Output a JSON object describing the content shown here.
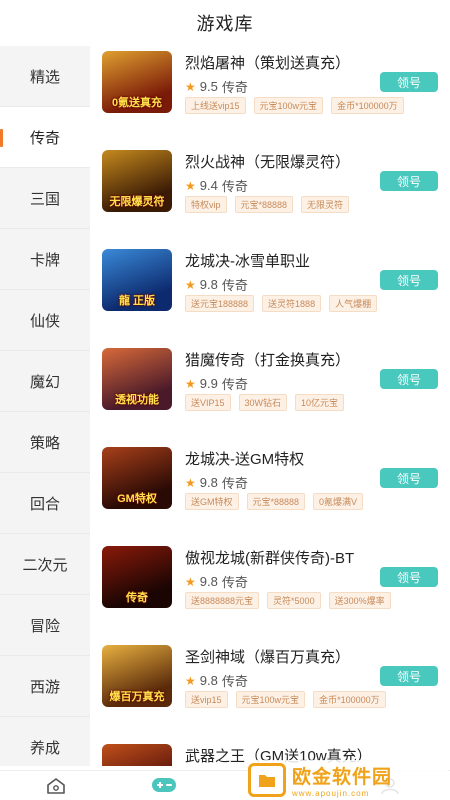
{
  "header": {
    "title": "游戏库"
  },
  "sidebar": {
    "items": [
      {
        "label": "精选",
        "active": false
      },
      {
        "label": "传奇",
        "active": true
      },
      {
        "label": "三国",
        "active": false
      },
      {
        "label": "卡牌",
        "active": false
      },
      {
        "label": "仙侠",
        "active": false
      },
      {
        "label": "魔幻",
        "active": false
      },
      {
        "label": "策略",
        "active": false
      },
      {
        "label": "回合",
        "active": false
      },
      {
        "label": "二次元",
        "active": false
      },
      {
        "label": "冒险",
        "active": false
      },
      {
        "label": "西游",
        "active": false
      },
      {
        "label": "养成",
        "active": false
      }
    ]
  },
  "games": [
    {
      "name": "烈焰屠神（策划送真充）",
      "rating": "9.5",
      "genre": "传奇",
      "button": "领号",
      "tags": [
        "上线送vip15",
        "元宝100w元宝",
        "金币*100000万"
      ],
      "thumb_text": "0氪送真充",
      "thumb_colors": [
        "#7a1a08",
        "#e0a030"
      ]
    },
    {
      "name": "烈火战神（无限爆灵符）",
      "rating": "9.4",
      "genre": "传奇",
      "button": "领号",
      "tags": [
        "特权vip",
        "元宝*88888",
        "无限灵符"
      ],
      "thumb_text": "无限爆灵符",
      "thumb_colors": [
        "#3a1a05",
        "#c58a1e"
      ]
    },
    {
      "name": "龙城决-冰雪单职业",
      "rating": "9.8",
      "genre": "传奇",
      "button": "领号",
      "tags": [
        "送元宝188888",
        "送灵符1888",
        "人气爆棚"
      ],
      "thumb_text": "龍 正版",
      "thumb_colors": [
        "#0d2a6e",
        "#3a8ad8"
      ]
    },
    {
      "name": "猎魔传奇（打金换真充）",
      "rating": "9.9",
      "genre": "传奇",
      "button": "领号",
      "tags": [
        "送VIP15",
        "30W钻石",
        "10亿元宝"
      ],
      "thumb_text": "透视功能",
      "thumb_colors": [
        "#4a1a2a",
        "#d86a3a"
      ]
    },
    {
      "name": "龙城决-送GM特权",
      "rating": "9.8",
      "genre": "传奇",
      "button": "领号",
      "tags": [
        "送GM特权",
        "元宝*88888",
        "0氪爆满V"
      ],
      "thumb_text": "GM特权",
      "thumb_colors": [
        "#2a0a05",
        "#a8401a"
      ]
    },
    {
      "name": "傲视龙城(新群侠传奇)-BT",
      "rating": "9.8",
      "genre": "传奇",
      "button": "领号",
      "tags": [
        "送8888888元宝",
        "灵符*5000",
        "送300%爆率"
      ],
      "thumb_text": "传奇",
      "thumb_colors": [
        "#1a0503",
        "#8a1a0a"
      ]
    },
    {
      "name": "圣剑神域（爆百万真充）",
      "rating": "9.8",
      "genre": "传奇",
      "button": "领号",
      "tags": [
        "送vip15",
        "元宝100w元宝",
        "金币*100000万"
      ],
      "thumb_text": "爆百万真充",
      "thumb_colors": [
        "#5a2a0a",
        "#e8b040"
      ]
    },
    {
      "name": "武器之王（GM送10w真充）",
      "rating": "",
      "genre": "",
      "button": "",
      "tags": [],
      "thumb_text": "",
      "thumb_colors": [
        "#4a0a0a",
        "#c0501a"
      ]
    }
  ],
  "tabbar": {
    "home_icon": "home-icon",
    "game_icon": "gamepad-icon",
    "user_icon": "user-icon"
  },
  "watermark": {
    "main": "欧金软件园",
    "url": "www.apoujin.com",
    "color": "#f0a31a"
  }
}
